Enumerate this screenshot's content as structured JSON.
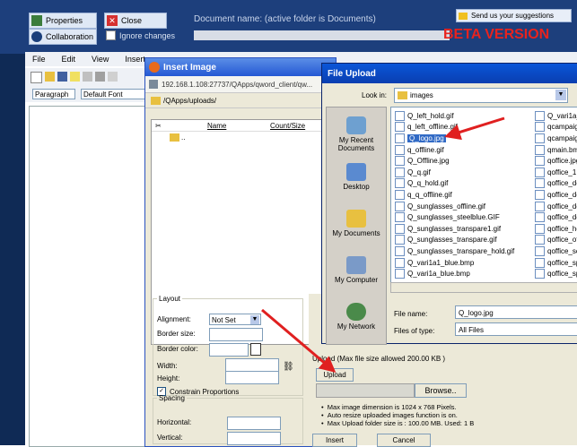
{
  "header": {
    "properties_label": "Properties",
    "close_label": "Close",
    "collaboration_label": "Collaboration",
    "ignore_changes_label": "Ignore changes",
    "document_name": "Document name: (active folder is Documents)",
    "suggestions_label": "Send us your suggestions",
    "beta_label": "BETA VERSION"
  },
  "menu": [
    "File",
    "Edit",
    "View",
    "Insert"
  ],
  "editor_toolbar": {
    "paragraph": "Paragraph",
    "font": "Default Font"
  },
  "insert_image": {
    "title": "Insert Image",
    "url": "192.168.1.108:27737/QApps/qword_client/qw...",
    "path": "/QApps/uploads/",
    "columns": {
      "name": "Name",
      "count": "Count/Size"
    },
    "parent_dir": "..",
    "layout_legend": "Layout",
    "alignment_label": "Alignment:",
    "alignment_value": "Not Set",
    "border_size_label": "Border size:",
    "border_color_label": "Border color:",
    "width_label": "Width:",
    "height_label": "Height:",
    "constrain_label": "Constrain Proportions",
    "spacing_legend": "Spacing",
    "horizontal_label": "Horizontal:",
    "vertical_label": "Vertical:",
    "upload_legend": "Upload (Max file size allowed 200.00 KB )",
    "upload_button": "Upload",
    "browse_button": "Browse..",
    "notes": [
      "Max image dimension is 1024 x 768 Pixels.",
      "Auto resize uploaded images function is on.",
      "Max Upload folder size is : 100.00 MB. Used: 1 B"
    ],
    "insert_button": "Insert",
    "cancel_button": "Cancel"
  },
  "file_upload": {
    "title": "File Upload",
    "look_in_label": "Look in:",
    "look_in_value": "images",
    "places": [
      "My Recent Documents",
      "Desktop",
      "My Documents",
      "My Computer",
      "My Network"
    ],
    "files_col1": [
      "Q_left_hold.gif",
      "q_left_offline.gif",
      "Q_logo.jpg",
      "q_offline.gif",
      "Q_Offline.jpg",
      "Q_q.gif",
      "Q_q_hold.gif",
      "q_q_offline.gif",
      "Q_sunglasses_offline.gif",
      "Q_sunglasses_steelblue.GIF",
      "Q_sunglasses_transpare1.gif",
      "Q_sunglasses_transpare.gif",
      "Q_sunglasses_transpare_hold.gif",
      "Q_vari1a1_blue.bmp",
      "Q_vari1a_blue.bmp"
    ],
    "files_col2": [
      "Q_vari1a_",
      "qcampaigr",
      "qcampaigr",
      "qmain.bmp",
      "qoffice.jpg",
      "qoffice_1.",
      "qoffice_dc",
      "qoffice_dc",
      "qoffice_dc",
      "qoffice_dc",
      "qoffice_hc",
      "qoffice_of",
      "qoffice_sc",
      "qoffice_sp",
      "qoffice_sp"
    ],
    "selected_file": "Q_logo.jpg",
    "file_name_label": "File name:",
    "file_name_value": "Q_logo.jpg",
    "files_of_type_label": "Files of type:",
    "files_of_type_value": "All Files"
  },
  "colors": {
    "header_bg": "#1d3f7c",
    "beta": "#e8231e",
    "arrow": "#e02020",
    "titlebar": "#2458d4"
  }
}
